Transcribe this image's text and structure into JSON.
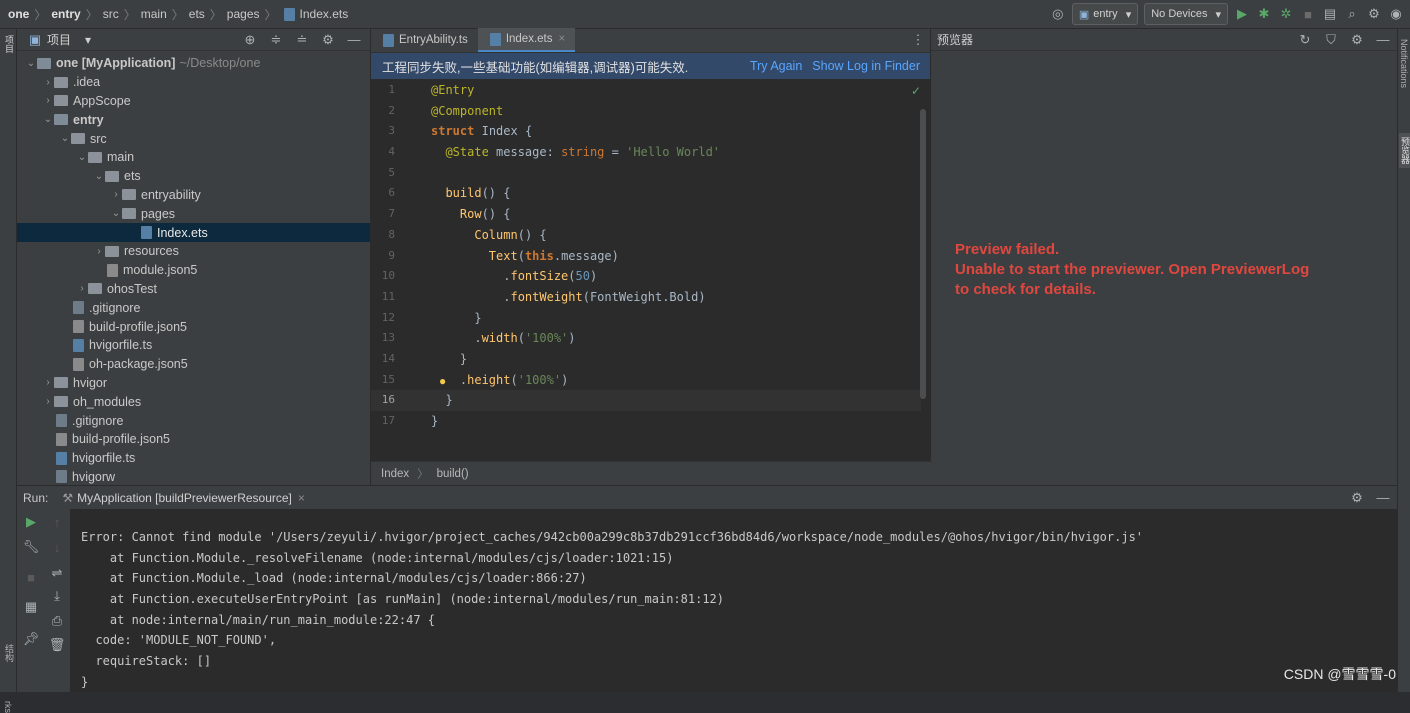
{
  "breadcrumb": [
    "one",
    "entry",
    "src",
    "main",
    "ets",
    "pages",
    "Index.ets"
  ],
  "toolbar": {
    "config": "entry",
    "device": "No Devices"
  },
  "left_strip_label": "项目",
  "project": {
    "title": "项目",
    "items": [
      {
        "indent": 0,
        "arrow": "v",
        "kind": "mod",
        "label": "one [MyApplication]",
        "extra": "~/Desktop/one",
        "bold": true
      },
      {
        "indent": 1,
        "arrow": ">",
        "kind": "fold",
        "label": ".idea"
      },
      {
        "indent": 1,
        "arrow": ">",
        "kind": "fold",
        "label": "AppScope"
      },
      {
        "indent": 1,
        "arrow": "v",
        "kind": "mod",
        "label": "entry",
        "bold": true
      },
      {
        "indent": 2,
        "arrow": "v",
        "kind": "fold",
        "label": "src"
      },
      {
        "indent": 3,
        "arrow": "v",
        "kind": "fold",
        "label": "main"
      },
      {
        "indent": 4,
        "arrow": "v",
        "kind": "fold",
        "label": "ets"
      },
      {
        "indent": 5,
        "arrow": ">",
        "kind": "fold",
        "label": "entryability"
      },
      {
        "indent": 5,
        "arrow": "v",
        "kind": "fold",
        "label": "pages"
      },
      {
        "indent": 6,
        "arrow": "",
        "kind": "ts",
        "label": "Index.ets",
        "selected": true
      },
      {
        "indent": 4,
        "arrow": ">",
        "kind": "fold",
        "label": "resources"
      },
      {
        "indent": 4,
        "arrow": "",
        "kind": "json",
        "label": "module.json5"
      },
      {
        "indent": 3,
        "arrow": ">",
        "kind": "fold",
        "label": "ohosTest"
      },
      {
        "indent": 2,
        "arrow": "",
        "kind": "file",
        "label": ".gitignore"
      },
      {
        "indent": 2,
        "arrow": "",
        "kind": "json",
        "label": "build-profile.json5"
      },
      {
        "indent": 2,
        "arrow": "",
        "kind": "ts",
        "label": "hvigorfile.ts"
      },
      {
        "indent": 2,
        "arrow": "",
        "kind": "json",
        "label": "oh-package.json5"
      },
      {
        "indent": 1,
        "arrow": ">",
        "kind": "fold",
        "label": "hvigor"
      },
      {
        "indent": 1,
        "arrow": ">",
        "kind": "fold",
        "label": "oh_modules"
      },
      {
        "indent": 1,
        "arrow": "",
        "kind": "file",
        "label": ".gitignore"
      },
      {
        "indent": 1,
        "arrow": "",
        "kind": "json",
        "label": "build-profile.json5"
      },
      {
        "indent": 1,
        "arrow": "",
        "kind": "ts",
        "label": "hvigorfile.ts"
      },
      {
        "indent": 1,
        "arrow": "",
        "kind": "file",
        "label": "hvigorw"
      }
    ]
  },
  "editor": {
    "tabs": [
      {
        "label": "EntryAbility.ts",
        "active": false
      },
      {
        "label": "Index.ets",
        "active": true
      }
    ],
    "banner": {
      "message": "工程同步失败,一些基础功能(如编辑器,调试器)可能失效.",
      "try_again": "Try Again",
      "show_log": "Show Log in Finder"
    },
    "line_numbers": [
      "1",
      "2",
      "3",
      "4",
      "5",
      "6",
      "7",
      "8",
      "9",
      "10",
      "11",
      "12",
      "13",
      "14",
      "15",
      "16",
      "17"
    ],
    "footer": [
      "Index",
      "build()"
    ]
  },
  "preview": {
    "title": "预览器",
    "error_lines": [
      "Preview failed.",
      "Unable to start the previewer. Open PreviewerLog",
      "to check for details."
    ]
  },
  "run": {
    "label": "Run:",
    "tab": "MyApplication [buildPreviewerResource]",
    "console": [
      "Error: Cannot find module '/Users/zeyuli/.hvigor/project_caches/942cb00a299c8b37db291ccf36bd84d6/workspace/node_modules/@ohos/hvigor/bin/hvigor.js'",
      "    at Function.Module._resolveFilename (node:internal/modules/cjs/loader:1021:15)",
      "    at Function.Module._load (node:internal/modules/cjs/loader:866:27)",
      "    at Function.executeUserEntryPoint [as runMain] (node:internal/modules/run_main:81:12)",
      "    at node:internal/main/run_main_module:22:47 {",
      "  code: 'MODULE_NOT_FOUND',",
      "  requireStack: []",
      "}"
    ]
  },
  "right_strip": {
    "notifications": "Notifications",
    "preview_tab": "预览器"
  },
  "left_bottom_labels": [
    "结构",
    "rks"
  ],
  "watermark": "CSDN @雪雪雪-0"
}
